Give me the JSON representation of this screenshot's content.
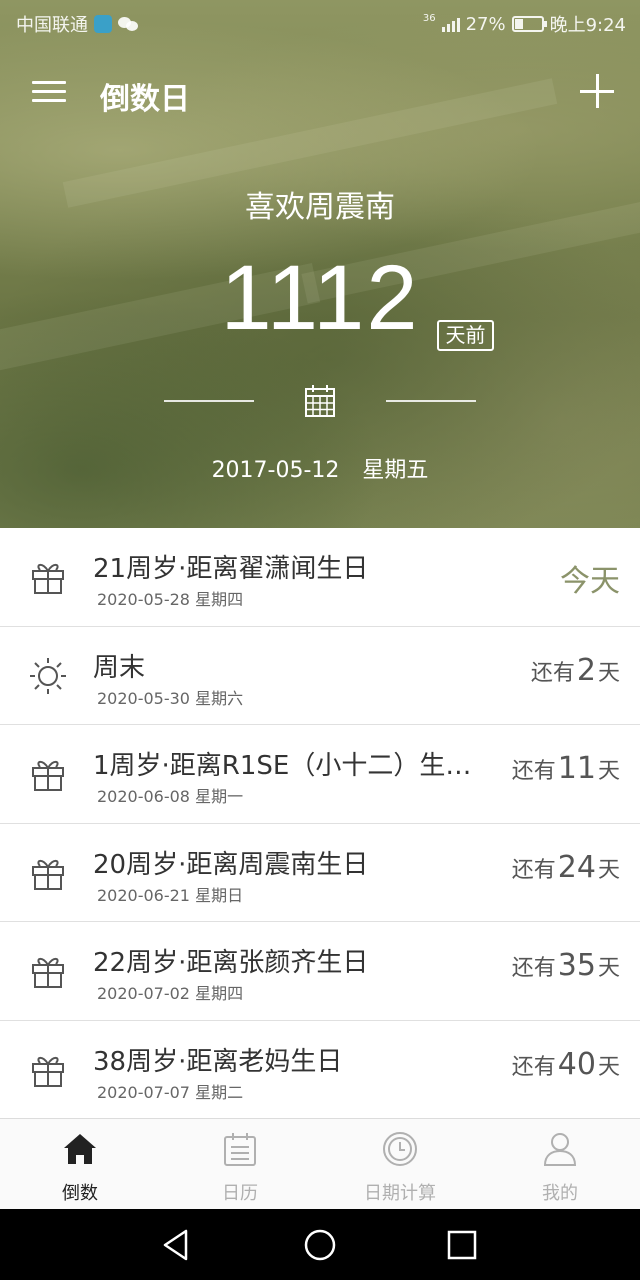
{
  "status_bar": {
    "carrier": "中国联通",
    "network": "36",
    "battery": "27%",
    "time": "晚上9:24"
  },
  "app_bar": {
    "title": "倒数日"
  },
  "featured": {
    "title": "喜欢周震南",
    "count": "1112",
    "unit": "天前",
    "date": "2017-05-12",
    "weekday": "星期五"
  },
  "events": [
    {
      "icon": "gift-icon",
      "title": "21周岁·距离翟潇闻生日",
      "date": "2020-05-28 星期四",
      "today_text": "今天",
      "prefix": "",
      "days": "",
      "suffix": ""
    },
    {
      "icon": "sun-icon",
      "title": "周末",
      "date": "2020-05-30 星期六",
      "today_text": "",
      "prefix": "还有",
      "days": "2",
      "suffix": "天"
    },
    {
      "icon": "gift-icon",
      "title": "1周岁·距离R1SE（小十二）生…",
      "date": "2020-06-08 星期一",
      "today_text": "",
      "prefix": "还有",
      "days": "11",
      "suffix": "天"
    },
    {
      "icon": "gift-icon",
      "title": "20周岁·距离周震南生日",
      "date": "2020-06-21 星期日",
      "today_text": "",
      "prefix": "还有",
      "days": "24",
      "suffix": "天"
    },
    {
      "icon": "gift-icon",
      "title": "22周岁·距离张颜齐生日",
      "date": "2020-07-02 星期四",
      "today_text": "",
      "prefix": "还有",
      "days": "35",
      "suffix": "天"
    },
    {
      "icon": "gift-icon",
      "title": "38周岁·距离老妈生日",
      "date": "2020-07-07 星期二",
      "today_text": "",
      "prefix": "还有",
      "days": "40",
      "suffix": "天"
    }
  ],
  "bottom_nav": {
    "items": [
      {
        "label": "倒数",
        "icon": "home-icon",
        "active": true
      },
      {
        "label": "日历",
        "icon": "calendar-icon",
        "active": false
      },
      {
        "label": "日期计算",
        "icon": "clock-icon",
        "active": false
      },
      {
        "label": "我的",
        "icon": "person-icon",
        "active": false
      }
    ]
  },
  "colors": {
    "hero_bg": "#7e8753",
    "today_accent": "#8b936a",
    "active_nav": "#222222",
    "inactive_nav": "#b0b0b0"
  }
}
